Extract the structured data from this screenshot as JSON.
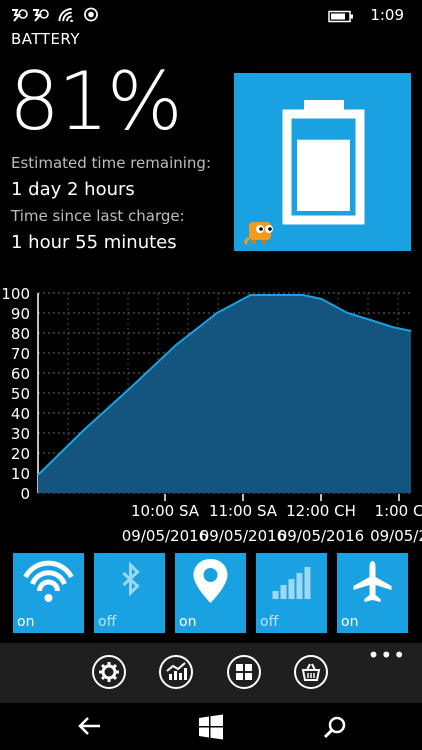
{
  "status_bar": {
    "time": "1:09",
    "icons": [
      "nfc-icon",
      "nfc-icon",
      "wifi-icon",
      "location-icon",
      "battery-icon"
    ]
  },
  "page_title": "BATTERY",
  "battery": {
    "percent": "81%",
    "estimated_label": "Estimated time remaining:",
    "estimated_value": "1 day 2 hours",
    "since_label": "Time since last charge:",
    "since_value": "1 hour 55 minutes",
    "tile_fill_fraction": 0.81
  },
  "chart_data": {
    "type": "area",
    "ylim": [
      0,
      100
    ],
    "yticks": [
      "100",
      "90",
      "80",
      "70",
      "60",
      "50",
      "40",
      "30",
      "20",
      "10",
      "0"
    ],
    "x_tick_times": [
      "10:00 SA",
      "11:00 SA",
      "12:00 CH",
      "1:00 C"
    ],
    "x_tick_dates": [
      "09/05/2016",
      "09/05/2016",
      "09/05/2016",
      "09/05/2"
    ],
    "x": [
      0,
      0.12,
      0.25,
      0.37,
      0.48,
      0.57,
      0.64,
      0.71,
      0.76,
      0.83,
      0.9,
      0.95,
      1.0
    ],
    "values": [
      9,
      31,
      53,
      74,
      90,
      99,
      99,
      99,
      97,
      90,
      86,
      83,
      81
    ],
    "grid": true,
    "fill_color": "#13557e",
    "line_color": "#1aa1e1"
  },
  "quick_tiles": [
    {
      "name": "wifi",
      "icon": "wifi-icon",
      "state": "on",
      "active": true
    },
    {
      "name": "bluetooth",
      "icon": "bluetooth-icon",
      "state": "off",
      "active": false
    },
    {
      "name": "location",
      "icon": "location-icon",
      "state": "on",
      "active": true
    },
    {
      "name": "cellular",
      "icon": "cellular-signal-icon",
      "state": "off",
      "active": false
    },
    {
      "name": "airplane",
      "icon": "airplane-icon",
      "state": "on",
      "active": true
    }
  ],
  "app_bar": {
    "buttons": [
      "settings-icon",
      "chart-icon",
      "apps-icon",
      "store-icon"
    ],
    "more": "•••"
  },
  "nav_bar": [
    "back-icon",
    "windows-icon",
    "search-icon"
  ],
  "colors": {
    "accent": "#1aa1e1",
    "background": "#000000",
    "appbar": "#1f1f1f"
  }
}
